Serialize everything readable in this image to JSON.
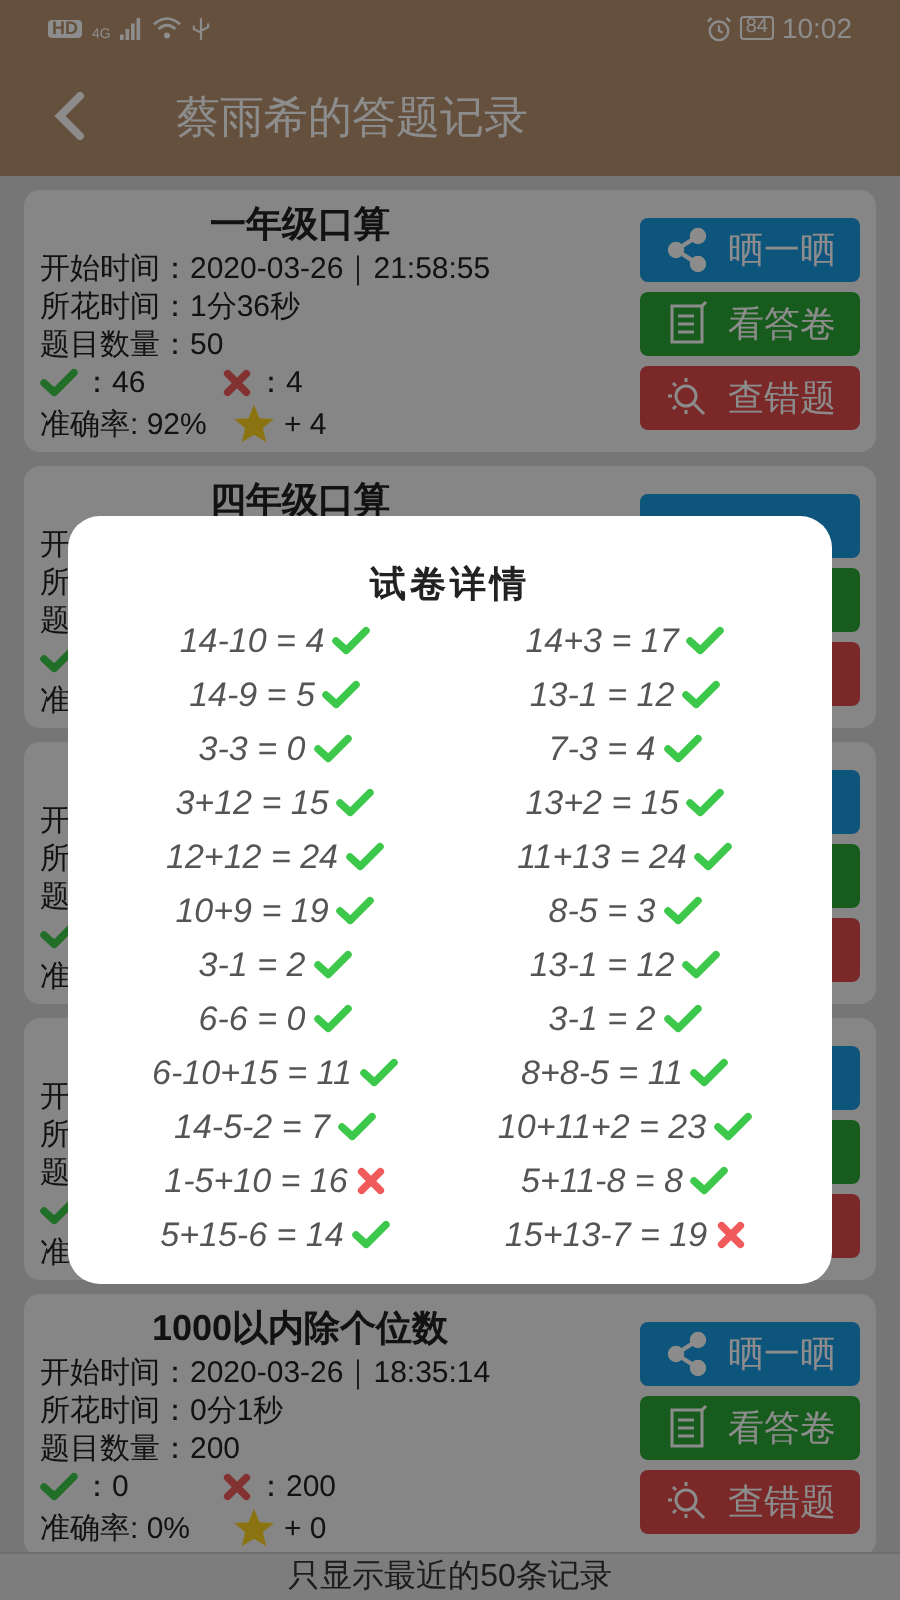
{
  "status_bar": {
    "hd_badge": "HD",
    "network": "4G",
    "battery": "84",
    "time": "10:02"
  },
  "header": {
    "title": "蔡雨希的答题记录"
  },
  "records": [
    {
      "title": "一年级口算",
      "start": "开始时间：2020-03-26｜21:58:55",
      "duration": "所花时间：1分36秒",
      "count": "题目数量：50",
      "correct": "：46",
      "wrong": "：4",
      "accuracy": "准确率: 92%",
      "stars_text": "+ 4",
      "buttons": [
        "晒一晒",
        "看答卷",
        "查错题"
      ]
    },
    {
      "title": "四年级口算",
      "start": "开",
      "duration": "所",
      "count": "题",
      "show_marks": true,
      "accuracy": "准"
    },
    {
      "start": "开",
      "duration": "所",
      "count": "题",
      "show_marks": true,
      "accuracy": "准"
    },
    {
      "start": "开",
      "duration": "所",
      "count": "题",
      "show_marks": true,
      "accuracy": "准"
    },
    {
      "title": "1000以内除个位数",
      "start": "开始时间：2020-03-26｜18:35:14",
      "duration": "所花时间：0分1秒",
      "count": "题目数量：200",
      "correct": "：0",
      "wrong": "：200",
      "accuracy": "准确率: 0%",
      "stars_text": "+ 0",
      "buttons": [
        "晒一晒",
        "看答卷",
        "查错题"
      ]
    }
  ],
  "footer": "只显示最近的50条记录",
  "dialog": {
    "title": "试卷详情",
    "questions": [
      {
        "text": "14-10 = 4",
        "correct": true
      },
      {
        "text": "14+3 = 17",
        "correct": true
      },
      {
        "text": "14-9 = 5",
        "correct": true
      },
      {
        "text": "13-1 = 12",
        "correct": true
      },
      {
        "text": "3-3 = 0",
        "correct": true
      },
      {
        "text": "7-3 = 4",
        "correct": true
      },
      {
        "text": "3+12 = 15",
        "correct": true
      },
      {
        "text": "13+2 = 15",
        "correct": true
      },
      {
        "text": "12+12 = 24",
        "correct": true
      },
      {
        "text": "11+13 = 24",
        "correct": true
      },
      {
        "text": "10+9 = 19",
        "correct": true
      },
      {
        "text": "8-5 = 3",
        "correct": true
      },
      {
        "text": "3-1 = 2",
        "correct": true
      },
      {
        "text": "13-1 = 12",
        "correct": true
      },
      {
        "text": "6-6 = 0",
        "correct": true
      },
      {
        "text": "3-1 = 2",
        "correct": true
      },
      {
        "text": "6-10+15 = 11",
        "correct": true
      },
      {
        "text": "8+8-5 = 11",
        "correct": true
      },
      {
        "text": "14-5-2 = 7",
        "correct": true
      },
      {
        "text": "10+11+2 = 23",
        "correct": true
      },
      {
        "text": "1-5+10 = 16",
        "correct": false
      },
      {
        "text": "5+11-8 = 8",
        "correct": true
      },
      {
        "text": "5+15-6 = 14",
        "correct": true
      },
      {
        "text": "15+13-7 = 19",
        "correct": false
      }
    ]
  }
}
